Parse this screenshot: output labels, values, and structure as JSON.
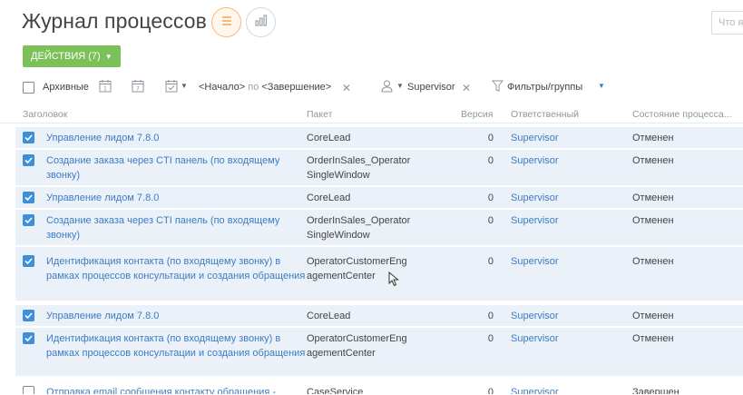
{
  "page": {
    "title": "Журнал процессов",
    "search_placeholder": "Что я",
    "view_icons": [
      "list-icon",
      "chart-icon"
    ]
  },
  "toolbar": {
    "actions_label": "ДЕЙСТВИЯ (7)",
    "actions_color": "#7cc05a"
  },
  "filters": {
    "archived_label": "Архивные",
    "date_start": "<Начало>",
    "date_sep": " по ",
    "date_end": "<Завершение>",
    "owner": "Supervisor",
    "filters_groups": "Фильтры/группы"
  },
  "columns": {
    "title": "Заголовок",
    "package": "Пакет",
    "version": "Версия",
    "owner": "Ответственный",
    "state": "Состояние процесса..."
  },
  "rows": [
    {
      "title": "Управление лидом 7.8.0",
      "package": "CoreLead",
      "version": "0",
      "owner": "Supervisor",
      "state": "Отменен",
      "checked": true
    },
    {
      "title": "Создание заказа через CTI панель (по входящему звонку)",
      "package": "OrderInSales_Operator SingleWindow",
      "version": "0",
      "owner": "Supervisor",
      "state": "Отменен",
      "checked": true
    },
    {
      "title": "Управление лидом 7.8.0",
      "package": "CoreLead",
      "version": "0",
      "owner": "Supervisor",
      "state": "Отменен",
      "checked": true
    },
    {
      "title": "Создание заказа через CTI панель (по входящему звонку)",
      "package": "OrderInSales_Operator SingleWindow",
      "version": "0",
      "owner": "Supervisor",
      "state": "Отменен",
      "checked": true
    },
    {
      "title": "Идентификация контакта (по входящему звонку) в рамках процессов консультации и создания обращения",
      "package": "OperatorCustomerEng agementCenter",
      "version": "0",
      "owner": "Supervisor",
      "state": "Отменен",
      "checked": true
    },
    {
      "title": "Управление лидом 7.8.0",
      "package": "CoreLead",
      "version": "0",
      "owner": "Supervisor",
      "state": "Отменен",
      "checked": true
    },
    {
      "title": "Идентификация контакта (по входящему звонку) в рамках процессов консультации и создания обращения",
      "package": "OperatorCustomerEng agementCenter",
      "version": "0",
      "owner": "Supervisor",
      "state": "Отменен",
      "checked": true
    },
    {
      "title": "Отправка email сообщения контакту обращения -",
      "package": "CaseService",
      "version": "0",
      "owner": "Supervisor",
      "state": "Завершен",
      "checked": false
    }
  ]
}
